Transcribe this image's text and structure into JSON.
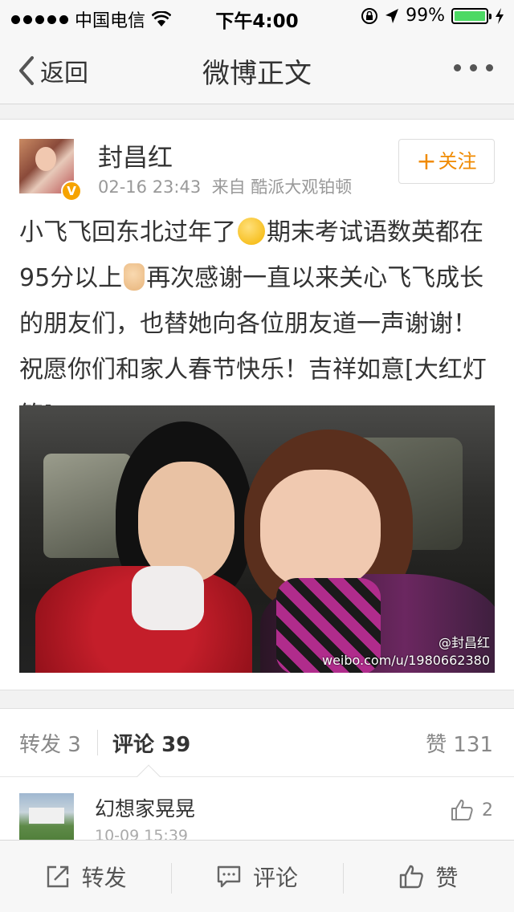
{
  "status_bar": {
    "carrier": "中国电信",
    "time": "下午4:00",
    "battery": "99%",
    "battery_level": 0.99
  },
  "nav": {
    "back_label": "返回",
    "title": "微博正文"
  },
  "post": {
    "author": "封昌红",
    "verified_badge": "V",
    "time": "02-16 23:43",
    "source_prefix": "来自",
    "source": "酷派大观铂顿",
    "follow_label": "关注",
    "text_part1": "小飞飞回东北过年了",
    "text_part2": "期末考试语数英都在95分以上",
    "text_part3": "再次感谢一直以来关心飞飞成长的朋友们，也替她向各位朋友道一声谢谢！祝愿你们和家人春节快乐！吉祥如意[大红灯笼]",
    "emoji_1": "blush-kiss-emoji",
    "emoji_2": "thumbs-up-emoji",
    "image_watermark_name": "@封昌红",
    "image_watermark_url": "weibo.com/u/1980662380"
  },
  "tabs": {
    "repost_label": "转发 3",
    "comment_label": "评论",
    "comment_count": "39",
    "like_label": "赞 131"
  },
  "comments": [
    {
      "name": "幻想家晃晃",
      "time": "10-09 15:39",
      "likes": "2"
    }
  ],
  "toolbar": {
    "repost_label": "转发",
    "comment_label": "评论",
    "like_label": "赞"
  },
  "colors": {
    "accent": "#f08a00",
    "verified": "#f6a300",
    "battery": "#4cd964"
  }
}
